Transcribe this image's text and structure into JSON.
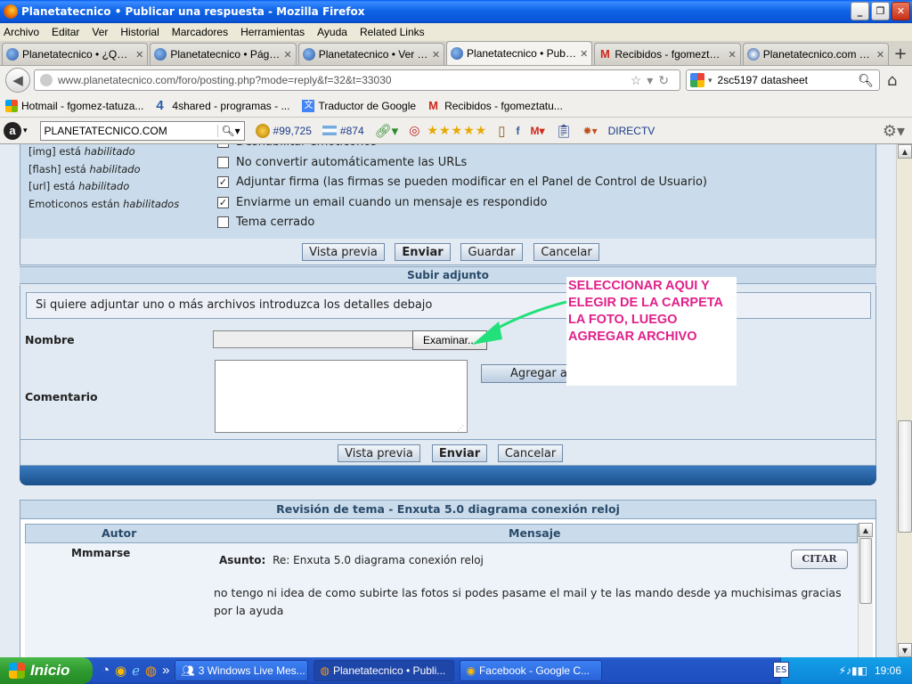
{
  "window": {
    "title": "Planetatecnico • Publicar una respuesta - Mozilla Firefox"
  },
  "menu": [
    "Archivo",
    "Editar",
    "Ver",
    "Historial",
    "Marcadores",
    "Herramientas",
    "Ayuda",
    "Related Links"
  ],
  "tabs": [
    {
      "label": "Planetatecnico • ¿Quién...",
      "icon": "globe-icon",
      "active": false
    },
    {
      "label": "Planetatecnico • Página...",
      "icon": "globe-icon",
      "active": false
    },
    {
      "label": "Planetatecnico • Ver Te...",
      "icon": "globe-icon",
      "active": false
    },
    {
      "label": "Planetatecnico • Public...",
      "icon": "globe-icon",
      "active": true
    },
    {
      "label": "Recibidos - fgomeztatuz...",
      "icon": "gmail-icon",
      "active": false
    },
    {
      "label": "Planetatecnico.com Site...",
      "icon": "at-icon",
      "active": false
    }
  ],
  "nav": {
    "url": "www.planetatecnico.com/foro/posting.php?mode=reply&f=32&t=33030",
    "search_value": "2sc5197 datasheet"
  },
  "bookmarks": [
    {
      "label": "Hotmail - fgomez-tatuza...",
      "icon": "msn-icon"
    },
    {
      "label": "4shared - programas - ...",
      "icon": "four-icon"
    },
    {
      "label": "Traductor de Google",
      "icon": "translate-icon"
    },
    {
      "label": "Recibidos - fgomeztatu...",
      "icon": "gmail-icon"
    }
  ],
  "toolbar": {
    "search_value": "PLANETATECNICO.COM",
    "rank": "#99,725",
    "rank2": "#874",
    "stars": "★★★★★",
    "directv": "DIRECTV"
  },
  "options": {
    "left_info": [
      {
        "prefix": "[img] está ",
        "value": "habilitado"
      },
      {
        "prefix": "[flash] está ",
        "value": "habilitado"
      },
      {
        "prefix": "[url] está ",
        "value": "habilitado"
      },
      {
        "prefix": "Emoticonos están ",
        "value": "habilitados"
      }
    ],
    "checkboxes": [
      {
        "label": "Deshabilitar emoticonos",
        "checked": false
      },
      {
        "label": "No convertir automáticamente las URLs",
        "checked": false
      },
      {
        "label": "Adjuntar firma (las firmas se pueden modificar en el Panel de Control de Usuario)",
        "checked": true
      },
      {
        "label": "Enviarme un email cuando un mensaje es respondido",
        "checked": true
      },
      {
        "label": "Tema cerrado",
        "checked": false
      }
    ]
  },
  "buttons": {
    "preview": "Vista previa",
    "submit": "Enviar",
    "save": "Guardar",
    "cancel": "Cancelar"
  },
  "upload": {
    "header": "Subir adjunto",
    "info": "Si quiere adjuntar uno o más archivos introduzca los detalles debajo",
    "name_label": "Nombre",
    "browse": "Examinar...",
    "comment_label": "Comentario",
    "add": "Agregar archivo"
  },
  "annotation": "SELECCIONAR AQUI Y ELEGIR DE LA CARPETA LA FOTO, LUEGO AGREGAR ARCHIVO",
  "review": {
    "header": "Revisión de tema - Enxuta 5.0 diagrama conexión reloj",
    "col_author": "Autor",
    "col_message": "Mensaje",
    "author": "Mmmarse",
    "subject_label": "Asunto:",
    "subject": "Re: Enxuta 5.0 diagrama conexión reloj",
    "quote": "CITAR",
    "message": "no tengo ni idea de como subirte las fotos si podes pasame el mail y te las mando desde ya muchisimas gracias por la ayuda"
  },
  "taskbar": {
    "start": "Inicio",
    "items": [
      {
        "label": "3 Windows Live Mes...",
        "active": false
      },
      {
        "label": "Planetatecnico • Publi...",
        "active": true
      },
      {
        "label": "Facebook - Google C...",
        "active": false
      }
    ],
    "lang": "ES",
    "clock": "19:06"
  }
}
